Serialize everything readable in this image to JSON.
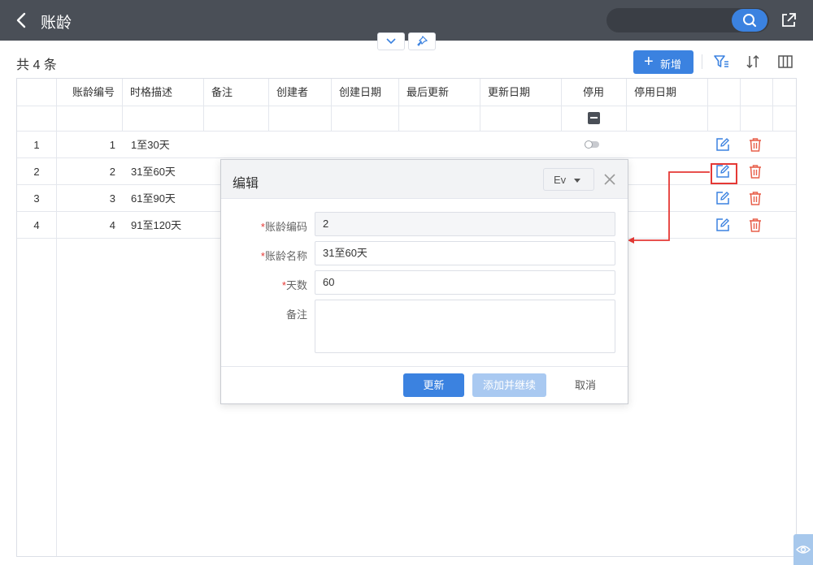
{
  "header": {
    "title": "账龄"
  },
  "toolbar": {
    "total": "共 4 条",
    "add_label": "新增"
  },
  "table": {
    "columns": [
      "账龄编号",
      "时格描述",
      "备注",
      "创建者",
      "创建日期",
      "最后更新",
      "更新日期",
      "停用",
      "停用日期"
    ],
    "rows": [
      {
        "index": "1",
        "code": "1",
        "desc": "1至30天"
      },
      {
        "index": "2",
        "code": "2",
        "desc": "31至60天"
      },
      {
        "index": "3",
        "code": "3",
        "desc": "61至90天"
      },
      {
        "index": "4",
        "code": "4",
        "desc": "91至120天"
      }
    ]
  },
  "dialog": {
    "title": "编辑",
    "lang": "Ev",
    "fields": {
      "code_label": "账龄编码",
      "code_value": "2",
      "name_label": "账龄名称",
      "name_value": "31至60天",
      "days_label": "天数",
      "days_value": "60",
      "note_label": "备注"
    },
    "update_label": "更新",
    "add_continue_label": "添加并继续",
    "cancel_label": "取消"
  },
  "colors": {
    "header_bg": "#4a4f57",
    "primary": "#3b82e0",
    "danger": "#e53935",
    "edit_icon": "#3b82e0",
    "delete_icon": "#e8604c"
  },
  "icons": [
    "back-arrow-icon",
    "search-icon",
    "share-icon",
    "chevron-down-icon",
    "pin-icon",
    "plus-icon",
    "filter-icon",
    "sort-icon",
    "columns-icon",
    "edit-icon",
    "delete-icon",
    "close-icon",
    "eye-icon"
  ]
}
